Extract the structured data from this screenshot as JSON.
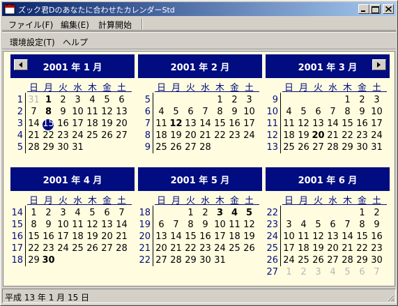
{
  "window": {
    "title": "ズック君Dのあなたに合わせたカレンダーStd"
  },
  "menu": {
    "items": [
      "ファイル(F)",
      "編集(E)",
      "計算開始"
    ],
    "items2": [
      "環境設定(T)",
      "ヘルプ"
    ]
  },
  "nav": {
    "prev": "previous-month",
    "next": "next-month"
  },
  "weekday_headers": [
    "日",
    "月",
    "火",
    "水",
    "木",
    "金",
    "土"
  ],
  "months": [
    {
      "title": "2001 年 1 月",
      "weeks": [
        {
          "num": "1",
          "days": [
            "31",
            "1",
            "2",
            "3",
            "4",
            "5",
            "6"
          ],
          "styles": [
            "grey",
            "bold",
            "",
            "",
            "",
            "",
            ""
          ]
        },
        {
          "num": "2",
          "days": [
            "7",
            "8",
            "9",
            "10",
            "11",
            "12",
            "13"
          ],
          "styles": [
            "",
            "bold",
            "",
            "",
            "",
            "",
            ""
          ]
        },
        {
          "num": "3",
          "days": [
            "14",
            "15",
            "16",
            "17",
            "18",
            "19",
            "20"
          ],
          "styles": [
            "",
            "today",
            "",
            "",
            "",
            "",
            ""
          ]
        },
        {
          "num": "4",
          "days": [
            "21",
            "22",
            "23",
            "24",
            "25",
            "26",
            "27"
          ],
          "styles": [
            "",
            "",
            "",
            "",
            "",
            "",
            ""
          ]
        },
        {
          "num": "5",
          "days": [
            "28",
            "29",
            "30",
            "31",
            "",
            "",
            ""
          ],
          "styles": [
            "",
            "",
            "",
            "",
            "",
            "",
            ""
          ]
        }
      ]
    },
    {
      "title": "2001 年 2 月",
      "weeks": [
        {
          "num": "5",
          "days": [
            "",
            "",
            "",
            "",
            "1",
            "2",
            "3"
          ],
          "styles": [
            "",
            "",
            "",
            "",
            "",
            "",
            ""
          ]
        },
        {
          "num": "6",
          "days": [
            "4",
            "5",
            "6",
            "7",
            "8",
            "9",
            "10"
          ],
          "styles": [
            "",
            "",
            "",
            "",
            "",
            "",
            ""
          ]
        },
        {
          "num": "7",
          "days": [
            "11",
            "12",
            "13",
            "14",
            "15",
            "16",
            "17"
          ],
          "styles": [
            "",
            "bold",
            "",
            "",
            "",
            "",
            ""
          ]
        },
        {
          "num": "8",
          "days": [
            "18",
            "19",
            "20",
            "21",
            "22",
            "23",
            "24"
          ],
          "styles": [
            "",
            "",
            "",
            "",
            "",
            "",
            ""
          ]
        },
        {
          "num": "9",
          "days": [
            "25",
            "26",
            "27",
            "28",
            "",
            "",
            ""
          ],
          "styles": [
            "",
            "",
            "",
            "",
            "",
            "",
            ""
          ]
        }
      ]
    },
    {
      "title": "2001 年 3 月",
      "weeks": [
        {
          "num": "9",
          "days": [
            "",
            "",
            "",
            "",
            "1",
            "2",
            "3"
          ],
          "styles": [
            "",
            "",
            "",
            "",
            "",
            "",
            ""
          ]
        },
        {
          "num": "10",
          "days": [
            "4",
            "5",
            "6",
            "7",
            "8",
            "9",
            "10"
          ],
          "styles": [
            "",
            "",
            "",
            "",
            "",
            "",
            ""
          ]
        },
        {
          "num": "11",
          "days": [
            "11",
            "12",
            "13",
            "14",
            "15",
            "16",
            "17"
          ],
          "styles": [
            "",
            "",
            "",
            "",
            "",
            "",
            ""
          ]
        },
        {
          "num": "12",
          "days": [
            "18",
            "19",
            "20",
            "21",
            "22",
            "23",
            "24"
          ],
          "styles": [
            "",
            "",
            "bold",
            "",
            "",
            "",
            ""
          ]
        },
        {
          "num": "13",
          "days": [
            "25",
            "26",
            "27",
            "28",
            "29",
            "30",
            "31"
          ],
          "styles": [
            "",
            "",
            "",
            "",
            "",
            "",
            ""
          ]
        }
      ]
    },
    {
      "title": "2001 年 4 月",
      "weeks": [
        {
          "num": "14",
          "days": [
            "1",
            "2",
            "3",
            "4",
            "5",
            "6",
            "7"
          ],
          "styles": [
            "",
            "",
            "",
            "",
            "",
            "",
            ""
          ]
        },
        {
          "num": "15",
          "days": [
            "8",
            "9",
            "10",
            "11",
            "12",
            "13",
            "14"
          ],
          "styles": [
            "",
            "",
            "",
            "",
            "",
            "",
            ""
          ]
        },
        {
          "num": "16",
          "days": [
            "15",
            "16",
            "17",
            "18",
            "19",
            "20",
            "21"
          ],
          "styles": [
            "",
            "",
            "",
            "",
            "",
            "",
            ""
          ]
        },
        {
          "num": "17",
          "days": [
            "22",
            "23",
            "24",
            "25",
            "26",
            "27",
            "28"
          ],
          "styles": [
            "",
            "",
            "",
            "",
            "",
            "",
            ""
          ]
        },
        {
          "num": "18",
          "days": [
            "29",
            "30",
            "",
            "",
            "",
            "",
            ""
          ],
          "styles": [
            "",
            "bold",
            "",
            "",
            "",
            "",
            ""
          ]
        }
      ]
    },
    {
      "title": "2001 年 5 月",
      "weeks": [
        {
          "num": "18",
          "days": [
            "",
            "",
            "1",
            "2",
            "3",
            "4",
            "5"
          ],
          "styles": [
            "",
            "",
            "",
            "",
            "bold",
            "bold",
            "bold"
          ]
        },
        {
          "num": "19",
          "days": [
            "6",
            "7",
            "8",
            "9",
            "10",
            "11",
            "12"
          ],
          "styles": [
            "",
            "",
            "",
            "",
            "",
            "",
            ""
          ]
        },
        {
          "num": "20",
          "days": [
            "13",
            "14",
            "15",
            "16",
            "17",
            "18",
            "19"
          ],
          "styles": [
            "",
            "",
            "",
            "",
            "",
            "",
            ""
          ]
        },
        {
          "num": "21",
          "days": [
            "20",
            "21",
            "22",
            "23",
            "24",
            "25",
            "26"
          ],
          "styles": [
            "",
            "",
            "",
            "",
            "",
            "",
            ""
          ]
        },
        {
          "num": "22",
          "days": [
            "27",
            "28",
            "29",
            "30",
            "31",
            "",
            ""
          ],
          "styles": [
            "",
            "",
            "",
            "",
            "",
            "",
            ""
          ]
        }
      ]
    },
    {
      "title": "2001 年 6 月",
      "weeks": [
        {
          "num": "22",
          "days": [
            "",
            "",
            "",
            "",
            "",
            "1",
            "2"
          ],
          "styles": [
            "",
            "",
            "",
            "",
            "",
            "",
            ""
          ]
        },
        {
          "num": "23",
          "days": [
            "3",
            "4",
            "5",
            "6",
            "7",
            "8",
            "9"
          ],
          "styles": [
            "",
            "",
            "",
            "",
            "",
            "",
            ""
          ]
        },
        {
          "num": "24",
          "days": [
            "10",
            "11",
            "12",
            "13",
            "14",
            "15",
            "16"
          ],
          "styles": [
            "",
            "",
            "",
            "",
            "",
            "",
            ""
          ]
        },
        {
          "num": "25",
          "days": [
            "17",
            "18",
            "19",
            "20",
            "21",
            "22",
            "23"
          ],
          "styles": [
            "",
            "",
            "",
            "",
            "",
            "",
            ""
          ]
        },
        {
          "num": "26",
          "days": [
            "24",
            "25",
            "26",
            "27",
            "28",
            "29",
            "30"
          ],
          "styles": [
            "",
            "",
            "",
            "",
            "",
            "",
            ""
          ]
        },
        {
          "num": "27",
          "days": [
            "1",
            "2",
            "3",
            "4",
            "5",
            "6",
            "7"
          ],
          "styles": [
            "grey",
            "grey",
            "grey",
            "grey",
            "grey",
            "grey",
            "grey"
          ]
        }
      ]
    }
  ],
  "status": {
    "text": "平成 13 年 1 月 15 日"
  },
  "colors": {
    "header_bg": "#000c80",
    "client_bg": "#fffce0",
    "title_gradient_start": "#0a246a",
    "title_gradient_end": "#a6caf0"
  }
}
